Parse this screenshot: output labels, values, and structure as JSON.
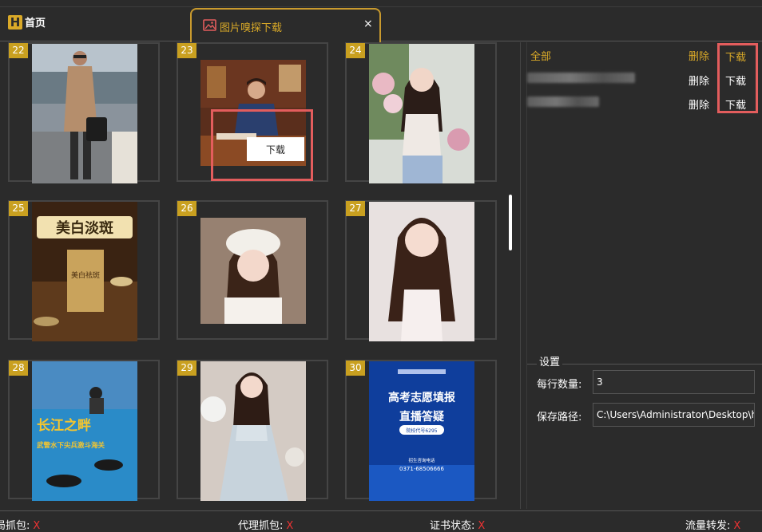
{
  "tabs": {
    "home_label": "首页",
    "home_logo": "H",
    "active_label": "图片嗅探下载",
    "close": "×"
  },
  "cards": [
    {
      "num": "22"
    },
    {
      "num": "23"
    },
    {
      "num": "24"
    },
    {
      "num": "25"
    },
    {
      "num": "26"
    },
    {
      "num": "27"
    },
    {
      "num": "28"
    },
    {
      "num": "29"
    },
    {
      "num": "30"
    }
  ],
  "thumb_text": {
    "book_title": "美白淡斑",
    "book_cover": "美白祛斑",
    "poster_river": "长江之畔",
    "poster_river_sub": "武警水下尖兵激斗海关",
    "poster_ad": "高考志愿填报",
    "poster_ad2": "直播答疑",
    "poster_ad_tag": "院校代号6295",
    "poster_ad_phone_label": "招生咨询电话",
    "poster_ad_phone": "0371-68506666"
  },
  "popup": {
    "download": "下载"
  },
  "panel": {
    "all": "全部",
    "delete_all": "删除",
    "download_all": "下载",
    "rows": [
      {
        "delete": "删除",
        "download": "下载"
      },
      {
        "delete": "删除",
        "download": "下载"
      }
    ]
  },
  "settings": {
    "title": "设置",
    "per_row_label": "每行数量:",
    "per_row_value": "3",
    "save_path_label": "保存路径:",
    "save_path_value": "C:\\Users\\Administrator\\Desktop\\h"
  },
  "status": [
    {
      "label": "局抓包:",
      "value": "X"
    },
    {
      "label": "代理抓包:",
      "value": "X"
    },
    {
      "label": "证书状态:",
      "value": "X"
    },
    {
      "label": "流量转发:",
      "value": "X"
    }
  ],
  "colors": {
    "accent": "#d9a928",
    "highlight": "#e35d5d",
    "badge": "#c9a020",
    "bg": "#2b2b2b",
    "status_x": "#e33333"
  }
}
